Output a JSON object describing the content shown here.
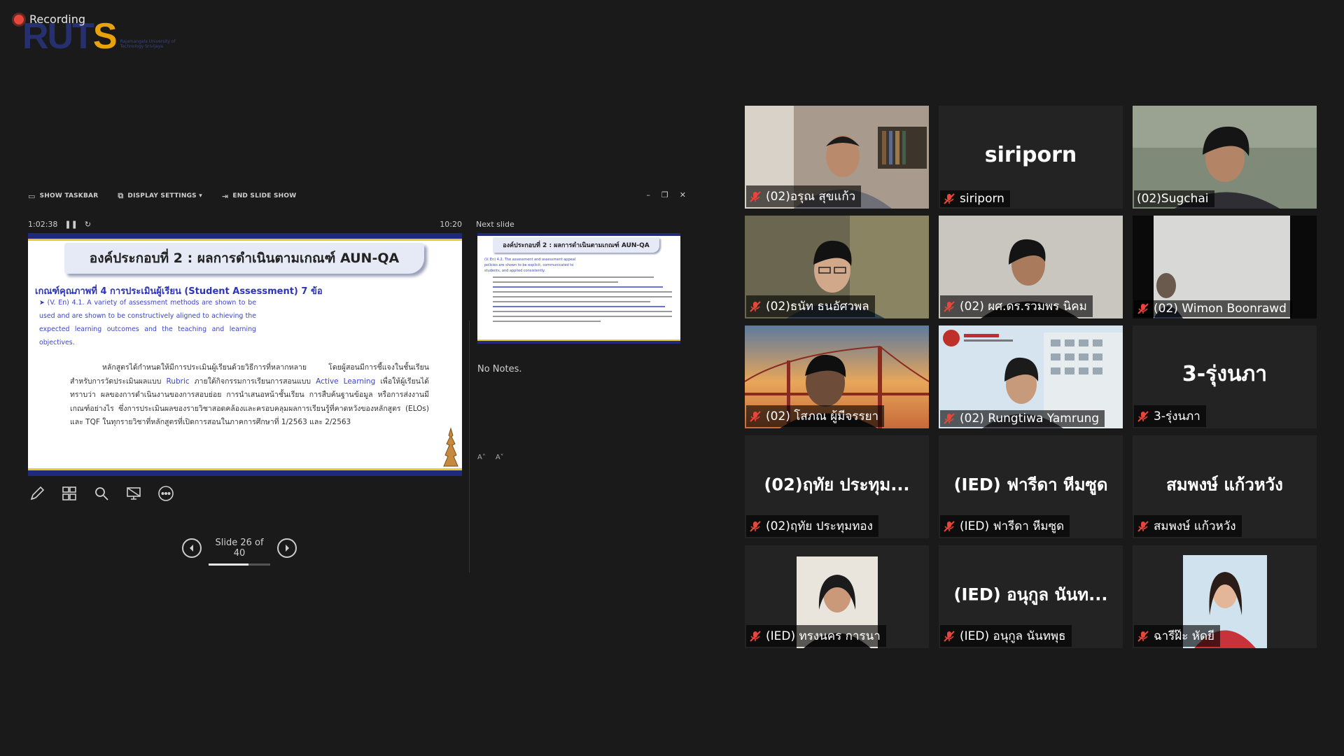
{
  "recording": {
    "label": "Recording"
  },
  "logo": {
    "brand_main": "RUT",
    "brand_accent": "S",
    "tagline": "Rajamangala University of Technology Srivijaya"
  },
  "presenter": {
    "toolbar": {
      "show_taskbar": "SHOW TASKBAR",
      "display_settings": "DISPLAY SETTINGS ▾",
      "end_slide_show": "END SLIDE SHOW"
    },
    "elapsed": "1:02:38",
    "clock": "10:20",
    "next_slide_label": "Next slide",
    "notes": "No Notes.",
    "slide_counter": "Slide 26 of 40",
    "progress": 0.65,
    "current_slide": {
      "title": "องค์ประกอบที่ 2 : ผลการดำเนินตามเกณฑ์ AUN-QA",
      "subhead": "เกณฑ์คุณภาพที่ 4 การประเมินผู้เรียน (Student Assessment) 7 ข้อ",
      "english_text": "(V. En) 4.1. A variety of assessment methods are shown to be used and are shown to be constructively aligned to achieving the expected learning outcomes and the teaching and learning objectives.",
      "thai_p1": "หลักสูตรได้กำหนดให้มีการประเมินผู้เรียนด้วยวิธีการที่หลากหลาย โดยผู้สอนมีการชี้แจงในชั้นเรียน สำหรับการวัดประเมินผลแบบ",
      "thai_hl1": "Rubric",
      "thai_p2": "ภายใต้กิจกรรมการเรียนการสอนแบบ",
      "thai_hl2": "Active Learning",
      "thai_p3": "เพื่อให้ผู้เรียนได้ทราบว่า ผลของการดำเนินงานของการสอบย่อย การนำเสนอหน้าชั้นเรียน การสืบค้นฐานข้อมูล หรือการส่งงานมีเกณฑ์อย่างไร ซึ่งการประเมินผลของรายวิชาสอดคล้องและครอบคลุมผลการเรียนรู้ที่คาดหวังของหลักสูตร (ELOs) และ TQF ในทุกรายวิชาที่หลักสูตรที่เปิดการสอนในภาคการศึกษาที่ 1/2563 และ 2/2563"
    },
    "next_slide": {
      "title": "องค์ประกอบที่ 2 : ผลการดำเนินตามเกณฑ์ AUN-QA",
      "english_text": "(V. En) 4.2. The assessment and assessment appeal policies are shown to be explicit, communicated to students, and applied consistently."
    }
  },
  "participants": [
    {
      "name": "(02)อรุณ สุขแก้ว",
      "video": true,
      "muted": true
    },
    {
      "name": "siriporn",
      "display": "siriporn",
      "video": false,
      "muted": true
    },
    {
      "name": "(02)Sugchai",
      "video": true,
      "muted": false,
      "active": true
    },
    {
      "name": "(02)ธนัท ธนอัศวพล",
      "video": true,
      "muted": true
    },
    {
      "name": "(02) ผศ.ดร.รวมพร นิคม",
      "video": true,
      "muted": true
    },
    {
      "name": "(02) Wimon Boonrawd",
      "video": true,
      "muted": true
    },
    {
      "name": "(02) โสภณ ผู้มีจรรยา",
      "video": true,
      "muted": true
    },
    {
      "name": "(02) Rungtiwa Yamrung",
      "video": true,
      "muted": true
    },
    {
      "name": "3-รุ่งนภา",
      "display": "3-รุ่งนภา",
      "video": false,
      "muted": true
    },
    {
      "name": "(02)ฤทัย ประทุมทอง",
      "display": "(02)ฤทัย ประทุม...",
      "video": false,
      "muted": true
    },
    {
      "name": "(IED) ฟารีดา หีมซูด",
      "display": "(IED) ฟารีดา หีมซูด",
      "video": false,
      "muted": true
    },
    {
      "name": "สมพงษ์ แก้วหวัง",
      "display": "สมพงษ์ แก้วหวัง",
      "video": false,
      "muted": true
    },
    {
      "name": "(IED) ทรงนคร การนา",
      "video": true,
      "muted": true
    },
    {
      "name": "(IED) อนุกูล นันทพุธ",
      "display": "(IED) อนุกูล นันท...",
      "video": false,
      "muted": true
    },
    {
      "name": "ฉารีฝ๊ะ หัดยี",
      "video": true,
      "muted": true
    }
  ],
  "colors": {
    "active_speaker": "#c9f35a",
    "muted_icon": "#e8463a",
    "slide_navy": "#1f2a7c",
    "slide_gold": "#e9c82a"
  }
}
